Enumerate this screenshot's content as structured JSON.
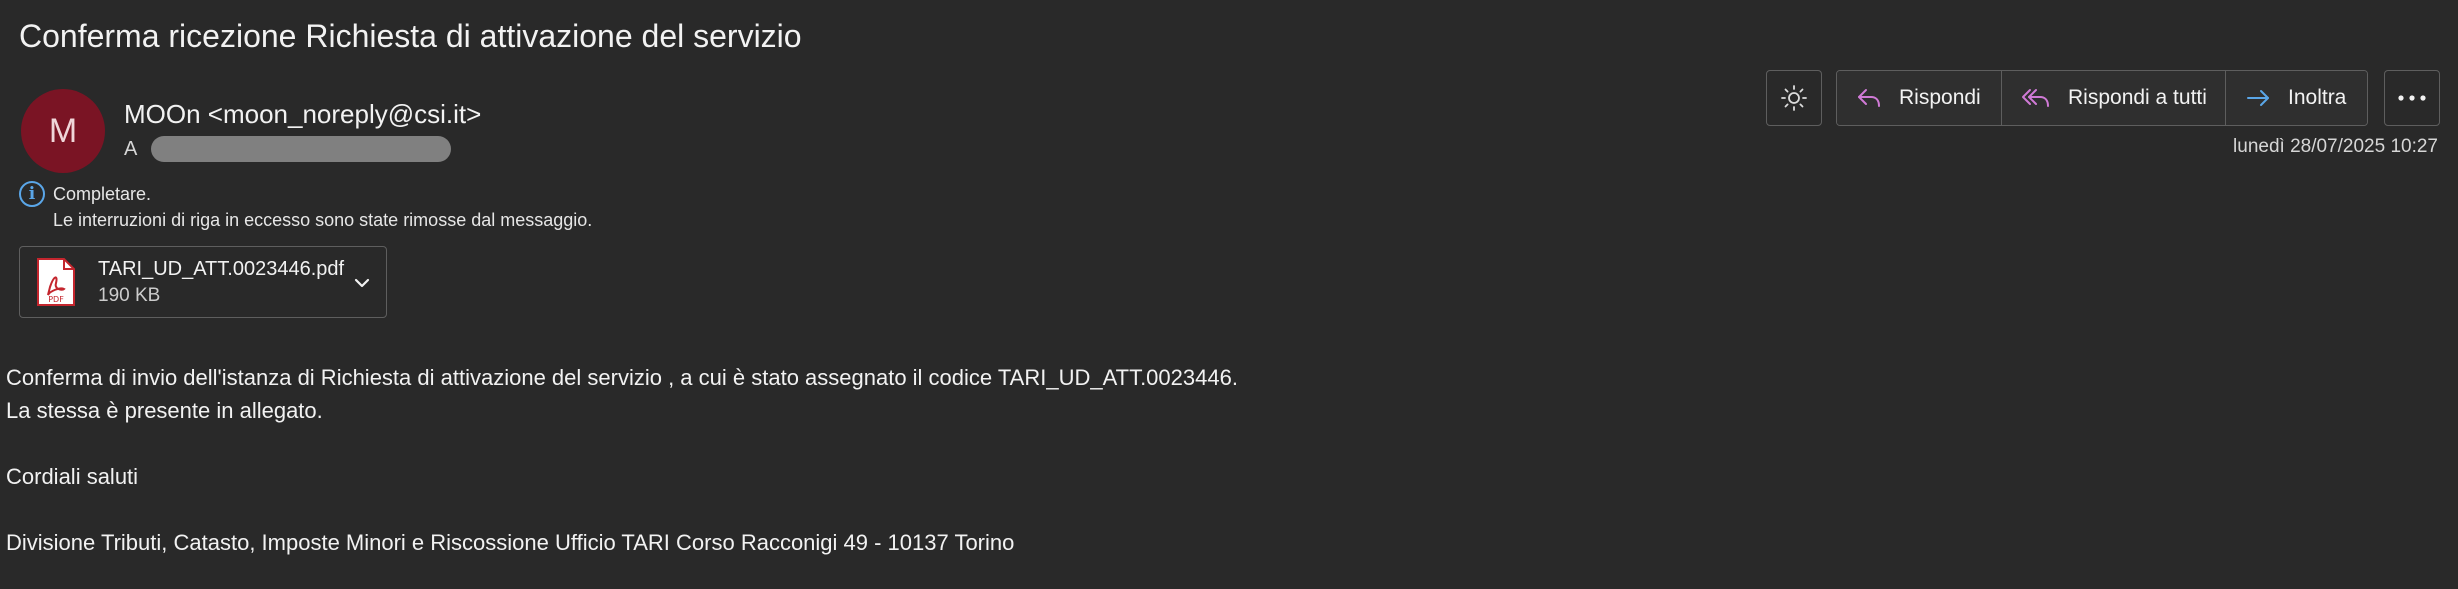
{
  "message": {
    "subject": "Conferma ricezione Richiesta di attivazione del servizio",
    "avatar_initial": "M",
    "sender": "MOOn <moon_noreply@csi.it>",
    "to_label": "A",
    "date": "lunedì 28/07/2025 10:27"
  },
  "info": {
    "line1": "Completare.",
    "line2": "Le interruzioni di riga in eccesso sono state rimosse dal messaggio."
  },
  "attachment": {
    "name": "TARI_UD_ATT.0023446.pdf",
    "size": "190 KB",
    "icon_label": "PDF"
  },
  "body": {
    "line1": "Conferma di invio dell'istanza di Richiesta di attivazione del servizio , a cui è stato assegnato il codice TARI_UD_ATT.0023446.",
    "line2": "La stessa è presente in allegato.",
    "line3": "Cordiali saluti",
    "line4": "Divisione Tributi, Catasto, Imposte Minori e Riscossione Ufficio TARI Corso Racconigi 49 - 10137 Torino"
  },
  "actions": {
    "reply": "Rispondi",
    "reply_all": "Rispondi a tutti",
    "forward": "Inoltra"
  },
  "colors": {
    "background": "#292929",
    "avatar": "#7a1424",
    "reply_icon": "#d07ad6",
    "forward_icon": "#5aa6e8",
    "info_icon": "#5aa6e8",
    "pdf_red": "#c4262e"
  },
  "icons": {
    "theme": "sun-icon",
    "reply": "reply-arrow-icon",
    "reply_all": "reply-all-arrow-icon",
    "forward": "forward-arrow-icon",
    "more": "ellipsis-icon",
    "info": "info-circle-icon",
    "attachment": "pdf-file-icon",
    "expand": "chevron-down-icon"
  }
}
